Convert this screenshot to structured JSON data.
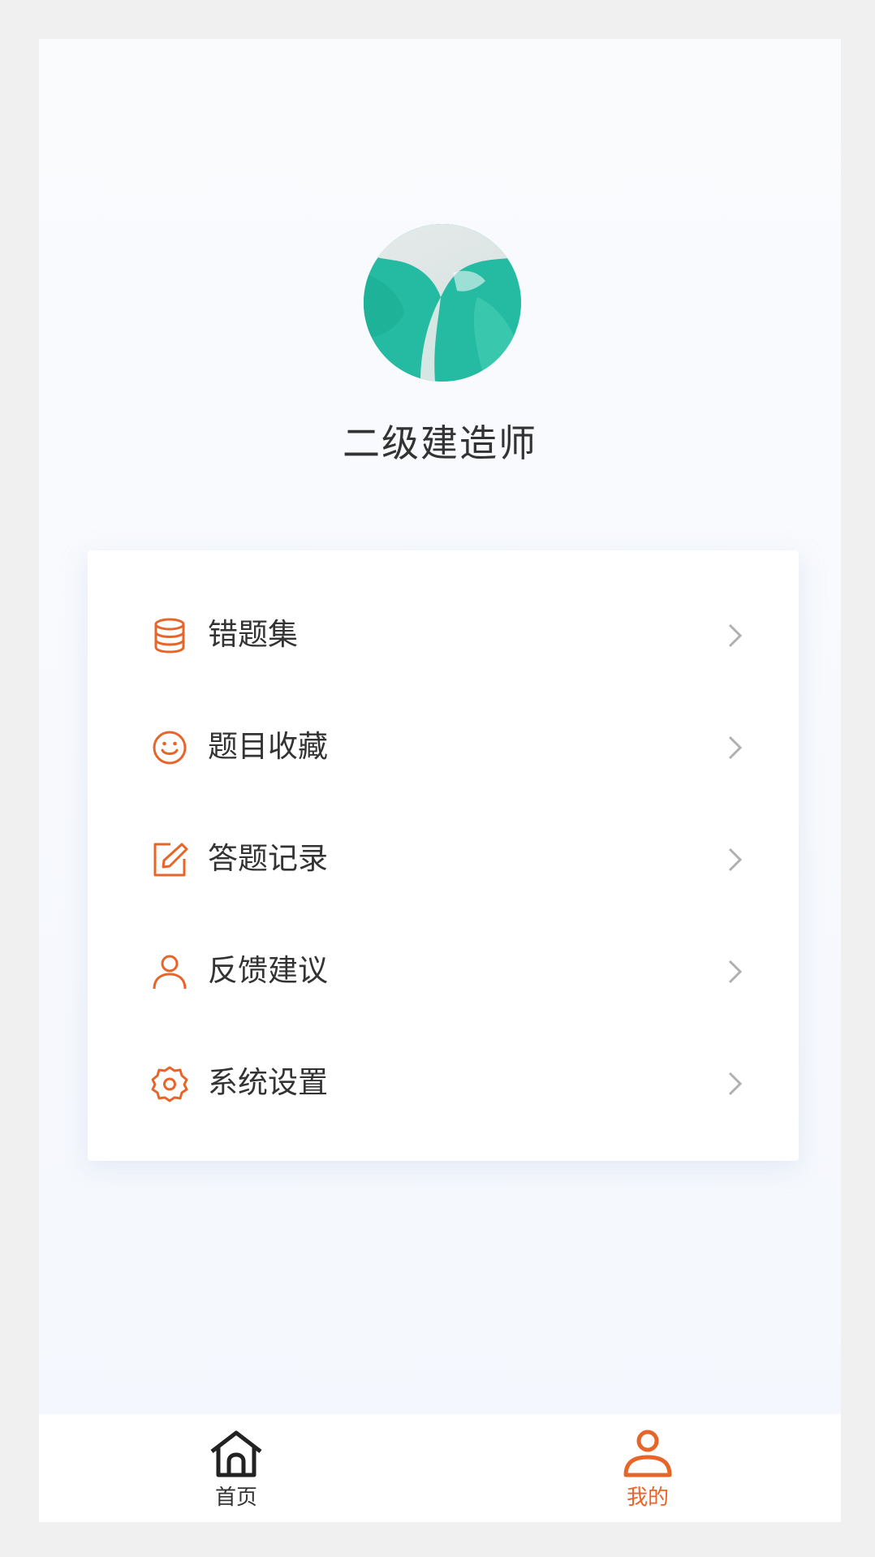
{
  "profile": {
    "name": "二级建造师"
  },
  "menu": {
    "items": [
      {
        "icon": "database-icon",
        "label": "错题集"
      },
      {
        "icon": "smile-icon",
        "label": "题目收藏"
      },
      {
        "icon": "edit-icon",
        "label": "答题记录"
      },
      {
        "icon": "user-icon",
        "label": "反馈建议"
      },
      {
        "icon": "gear-icon",
        "label": "系统设置"
      }
    ]
  },
  "tabbar": {
    "tabs": [
      {
        "icon": "home-icon",
        "label": "首页",
        "active": false
      },
      {
        "icon": "person-icon",
        "label": "我的",
        "active": true
      }
    ]
  },
  "colors": {
    "accent": "#e8652a",
    "text": "#333333",
    "chevron": "#b0b0b0",
    "inactive_tab": "#333333"
  }
}
